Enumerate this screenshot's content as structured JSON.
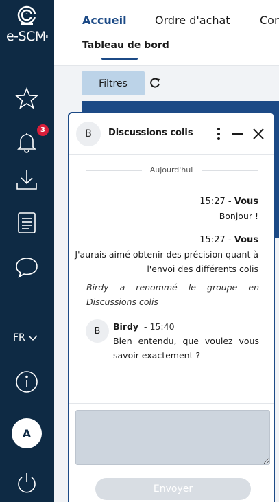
{
  "brand": {
    "name": "e-SCM",
    "suffix": ""
  },
  "sidebar": {
    "notifications_count": "3",
    "language": "FR",
    "user_initial": "A",
    "icons": [
      "star-icon",
      "bell-icon",
      "download-icon",
      "document-icon",
      "chat-icon",
      "info-icon",
      "power-icon"
    ]
  },
  "nav": {
    "tabs": [
      {
        "label": "Accueil",
        "active": true
      },
      {
        "label": "Ordre d'achat",
        "active": false
      },
      {
        "label": "Con",
        "active": false
      }
    ],
    "subtab": "Tableau de bord"
  },
  "toolbar": {
    "filter_label": "Filtres"
  },
  "chat": {
    "avatar_initial": "B",
    "title": "Discussions colis",
    "day_label": "Aujourd'hui",
    "messages": [
      {
        "time": "15:27",
        "author": "Vous",
        "text": "Bonjour !"
      },
      {
        "time": "15:27",
        "author": "Vous",
        "text_line1": "J'aurais aimé obtenir des précision quant à",
        "text_line2": "l'envoi des différents colis"
      }
    ],
    "system_message": "Birdy a renommé le groupe en Discussions colis",
    "reply": {
      "avatar_initial": "B",
      "author": "Birdy",
      "time": "15:40",
      "text": "Bien entendu, que voulez vous savoir exactement ?"
    },
    "input_value": "",
    "send_label": "Envoyer"
  },
  "colors": {
    "sidebar_bg": "#0e2a44",
    "accent": "#1c4a86",
    "badge": "#d91e3a",
    "filter_bg": "#bcd3e8"
  }
}
